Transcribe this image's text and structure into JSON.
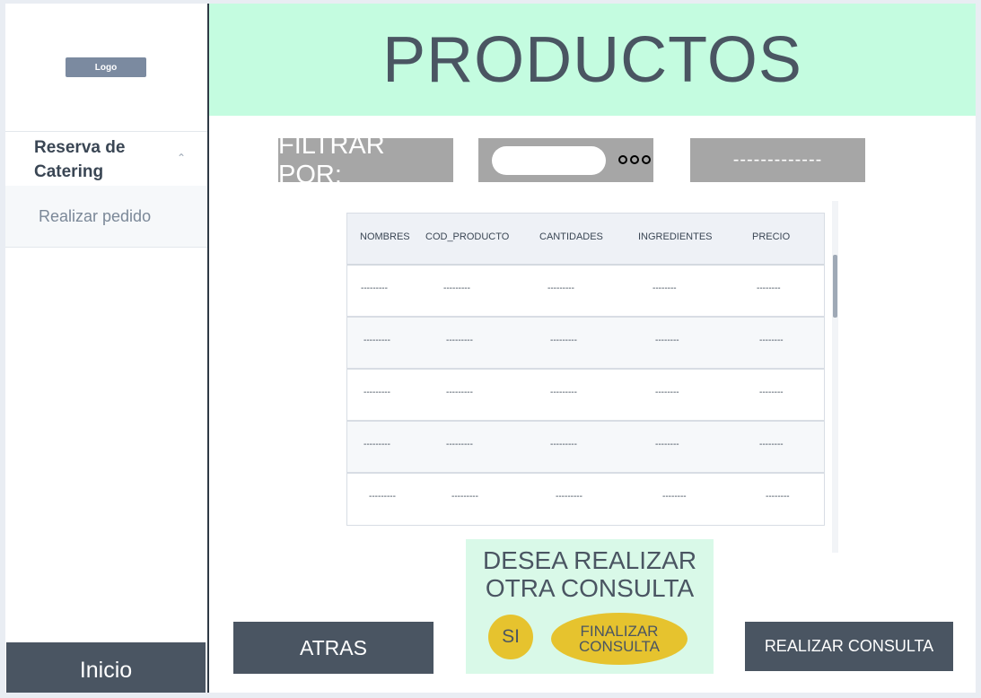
{
  "sidebar": {
    "logo": "Logo",
    "section_title": "Reserva de Catering",
    "chevron": "⌃",
    "item": "Realizar pedido",
    "home_button": "Inicio"
  },
  "header": {
    "title": "PRODUCTOS"
  },
  "filter": {
    "label": "FILTRAR POR:",
    "input_value": "",
    "more_icon": "ellipsis-icon",
    "select_value": "-------------"
  },
  "table": {
    "columns": [
      "NOMBRES",
      "COD_PRODUCTO",
      "CANTIDADES",
      "INGREDIENTES",
      "PRECIO"
    ],
    "rows": [
      [
        "---------",
        "---------",
        "---------",
        "--------",
        "--------"
      ],
      [
        "---------",
        "---------",
        "---------",
        "--------",
        "--------"
      ],
      [
        "---------",
        "---------",
        "---------",
        "--------",
        "--------"
      ],
      [
        "---------",
        "---------",
        "---------",
        "--------",
        "--------"
      ],
      [
        "---------",
        "---------",
        "---------",
        "--------",
        "--------"
      ]
    ]
  },
  "consulta": {
    "question": "DESEA REALIZAR OTRA CONSULTA",
    "yes_button": "SI",
    "finish_button": "FINALIZAR CONSULTA"
  },
  "actions": {
    "back_button": "ATRAS",
    "submit_button": "REALIZAR CONSULTA"
  },
  "colors": {
    "header_bg": "#c4fce0",
    "dark": "#4a5562",
    "filter_gray": "#a6a6a6",
    "accent_yellow": "#e6c32e",
    "panel_green": "#d9f9e8"
  }
}
